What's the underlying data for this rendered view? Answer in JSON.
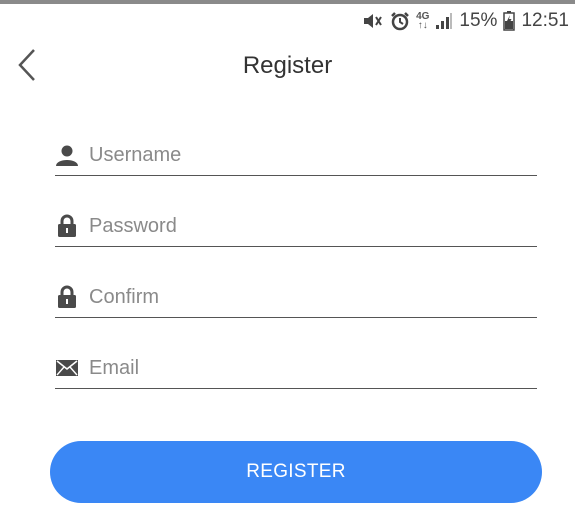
{
  "status_bar": {
    "network_top": "4G",
    "network_bottom": "↑↓",
    "battery_percent": "15%",
    "time": "12:51",
    "icons": [
      "mute-icon",
      "alarm-icon",
      "signal-icon",
      "battery-charging-icon"
    ]
  },
  "header": {
    "title": "Register",
    "back_icon": "chevron-left-icon"
  },
  "form": {
    "username": {
      "placeholder": "Username",
      "value": "",
      "icon": "user-icon"
    },
    "password": {
      "placeholder": "Password",
      "value": "",
      "icon": "lock-icon"
    },
    "confirm": {
      "placeholder": "Confirm",
      "value": "",
      "icon": "lock-icon"
    },
    "email": {
      "placeholder": "Email",
      "value": "",
      "icon": "envelope-icon"
    }
  },
  "actions": {
    "register_label": "REGISTER"
  },
  "colors": {
    "accent": "#3a87f5",
    "text": "#333333",
    "placeholder": "#8a8a8a",
    "underline": "#555555"
  }
}
